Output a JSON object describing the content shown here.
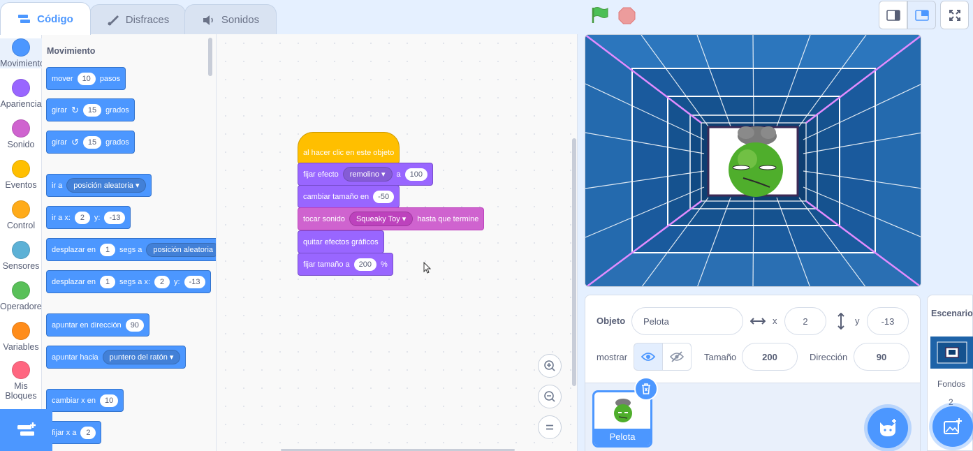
{
  "tabs": [
    {
      "label": "Código",
      "icon": "code-icon",
      "active": true
    },
    {
      "label": "Disfraces",
      "icon": "brush-icon",
      "active": false
    },
    {
      "label": "Sonidos",
      "icon": "speaker-icon",
      "active": false
    }
  ],
  "categories": [
    {
      "label": "Movimiento",
      "color": "#4c97ff"
    },
    {
      "label": "Apariencia",
      "color": "#9966ff"
    },
    {
      "label": "Sonido",
      "color": "#cf63cf"
    },
    {
      "label": "Eventos",
      "color": "#ffbf00"
    },
    {
      "label": "Control",
      "color": "#ffab19"
    },
    {
      "label": "Sensores",
      "color": "#5cb1d6"
    },
    {
      "label": "Operadores",
      "color": "#59c059"
    },
    {
      "label": "Variables",
      "color": "#ff8c1a"
    },
    {
      "label": "Mis Bloques",
      "color": "#ff6680"
    }
  ],
  "palette": {
    "title": "Movimiento",
    "move": {
      "a": "mover",
      "v": "10",
      "b": "pasos"
    },
    "turn_right": {
      "a": "girar",
      "v": "15",
      "b": "grados"
    },
    "turn_left": {
      "a": "girar",
      "v": "15",
      "b": "grados"
    },
    "goto": {
      "a": "ir a",
      "d": "posición aleatoria"
    },
    "goto_xy": {
      "a": "ir a x:",
      "x": "2",
      "b": "y:",
      "y": "-13"
    },
    "glide": {
      "a": "desplazar en",
      "v": "1",
      "b": "segs a",
      "d": "posición aleatoria"
    },
    "glide_xy": {
      "a": "desplazar en",
      "v": "1",
      "b": "segs a x:",
      "x": "2",
      "c": "y:",
      "y": "-13"
    },
    "point_dir": {
      "a": "apuntar en dirección",
      "v": "90"
    },
    "point_to": {
      "a": "apuntar hacia",
      "d": "puntero del ratón"
    },
    "change_x": {
      "a": "cambiar x en",
      "v": "10"
    },
    "set_x": {
      "a": "fijar x a",
      "v": "2"
    }
  },
  "script": {
    "hat": "al hacer clic en este objeto",
    "set_effect": {
      "a": "fijar efecto",
      "d": "remolino",
      "b": "a",
      "v": "100"
    },
    "change_size": {
      "a": "cambiar tamaño en",
      "v": "-50"
    },
    "play_sound": {
      "a": "tocar sonido",
      "d": "Squeaky Toy",
      "b": "hasta que termine"
    },
    "clear_effects": "quitar efectos gráficos",
    "set_size": {
      "a": "fijar tamaño a",
      "v": "200",
      "b": "%"
    }
  },
  "sprite_info": {
    "object_label": "Objeto",
    "name": "Pelota",
    "x_label": "x",
    "x": "2",
    "y_label": "y",
    "y": "-13",
    "show_label": "mostrar",
    "size_label": "Tamaño",
    "size": "200",
    "direction_label": "Dirección",
    "direction": "90"
  },
  "sprites": [
    {
      "name": "Pelota",
      "selected": true
    }
  ],
  "backdrop_panel": {
    "title": "Escenario",
    "backdrops_label": "Fondos",
    "backdrops_count": "2"
  },
  "colors": {
    "accent": "#4c97ff",
    "looks": "#9966ff",
    "sound": "#cf63cf",
    "event": "#ffbf00"
  }
}
